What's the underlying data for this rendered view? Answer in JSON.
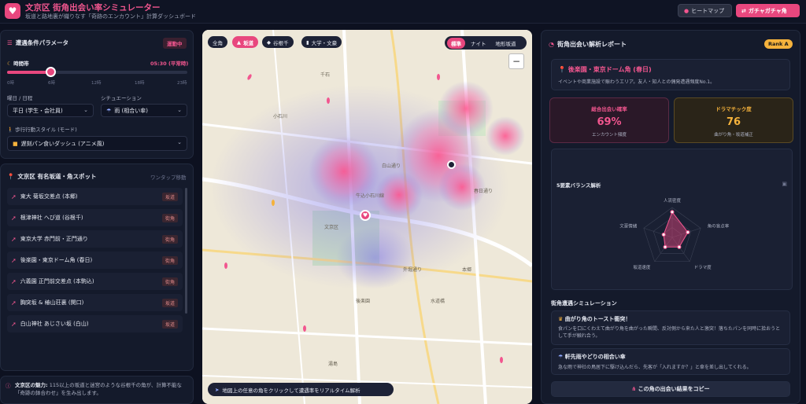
{
  "header": {
    "title": "文京区 街角出会い率シミュレーター",
    "subtitle": "坂道と路地裏が織りなす「奇跡のエンカウント」計算ダッシュボード",
    "heatmap_btn": "ヒートマップ",
    "gacha_btn": "ガチャガチャ角"
  },
  "params": {
    "title": "遭遇条件パラメータ",
    "badge": "運動中",
    "time_label": "時間帯",
    "time_value": "05:30 (平常時)",
    "ticks": [
      "0時",
      "6時",
      "12時",
      "18時",
      "23時"
    ],
    "slider_value": 0.24,
    "day_label": "曜日 / 日程",
    "day_value": "平日 (学生・会社員)",
    "situation_label": "シチュエーション",
    "situation_value": "雨 (相合い傘)",
    "style_label": "歩行行動スタイル (モード)",
    "style_value": "遅刻パン食いダッシュ (アニメ風)"
  },
  "spots": {
    "title": "文京区 有名坂道・角スポット",
    "hint": "ワンタップ移動",
    "items": [
      {
        "name": "東大 菊坂交差点 (本郷)",
        "tag": "坂道"
      },
      {
        "name": "根津神社 へび道 (谷根千)",
        "tag": "街角"
      },
      {
        "name": "東京大学 赤門前・正門通り",
        "tag": "街角"
      },
      {
        "name": "後楽園・東京ドーム角 (春日)",
        "tag": "街角"
      },
      {
        "name": "六義園 正門前交差点 (本駒込)",
        "tag": "街角"
      },
      {
        "name": "胸突坂 & 椿山荘裏 (関口)",
        "tag": "坂道"
      },
      {
        "name": "白山神社 あじさい坂 (白山)",
        "tag": "坂道"
      }
    ]
  },
  "footer": {
    "title": "文京区の魅力:",
    "text": "115以上の坂道と迷宮のような谷根千の角が、計算不能な「奇跡の鉢合わせ」を生み出します。"
  },
  "map": {
    "chips": [
      "全角",
      "坂道",
      "谷根千",
      "大学・文豪"
    ],
    "modes": [
      "標準",
      "ナイト",
      "地形坂道"
    ],
    "zoom": "−",
    "hint": "地図上の任意の角をクリックして遭遇率をリアルタイム解析",
    "places": [
      "千石",
      "小石川",
      "春日通り",
      "白山通り",
      "牛込小石川線",
      "文京区",
      "外堀通り",
      "水道橋",
      "本郷",
      "湯島",
      "後楽園"
    ]
  },
  "report": {
    "title": "街角出会い解析レポート",
    "rank": "Rank A",
    "spot_name": "後楽園・東京ドーム角 (春日)",
    "spot_desc": "イベントや商業施設で賑わうエリア。友人・知人との偶発遭遇頻度No.1。",
    "stat1_title": "総合出会い確率",
    "stat1_value": "69%",
    "stat1_sub": "エンカウント頻度",
    "stat2_title": "ドラマチック度",
    "stat2_value": "76",
    "stat2_sub": "曲がり角・坂道補正",
    "radar_title": "5要素バランス解析",
    "radar_labels": [
      "人流密度",
      "角の盲点率",
      "ドラマ度",
      "坂道速度",
      "文豪情緒"
    ],
    "radar_values": [
      0.85,
      0.55,
      0.4,
      0.4,
      0.3
    ],
    "sim_title": "街角遭遇シミュレーション",
    "sim1_title": "曲がり角のトースト衝突！",
    "sim1_text": "食パンを口にくわえて曲がり角を曲がった瞬間、反対側から来た人と激突！落ちたパンを同時に拾おうとして手が触れ合う。",
    "sim2_title": "軒先雨やどりの相合い傘",
    "sim2_text": "急な雨で神社の鳥居下に駆け込んだら、先客が「入れますか？」と傘を差し出してくれる。",
    "copy_btn": "この角の出会い結果をコピー"
  },
  "colors": {
    "accent": "#e8477e",
    "gold": "#f5b23c"
  }
}
